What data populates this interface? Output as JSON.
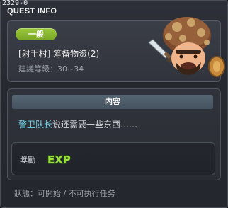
{
  "window": {
    "id_text": "2329-0",
    "title": "QUEST INFO"
  },
  "quest": {
    "category": "一般",
    "name": "[射手村] 筹备物资(2)",
    "level_label": "建議等級：",
    "level_range": "30~34",
    "avatar_icon": "mushroom-monster-icon"
  },
  "content": {
    "header": "内容",
    "npc_name": "警卫队长",
    "description_rest": "说还需要一些东西……",
    "reward_label": "獎勵",
    "reward_icon_text": "EXP"
  },
  "status": {
    "label": "狀態：",
    "state": "可開始",
    "separator": " / ",
    "note": "不可执行任务"
  },
  "colors": {
    "badge": "#8bb82f",
    "npc_text": "#6fd3e8",
    "exp": "#9be03a"
  }
}
